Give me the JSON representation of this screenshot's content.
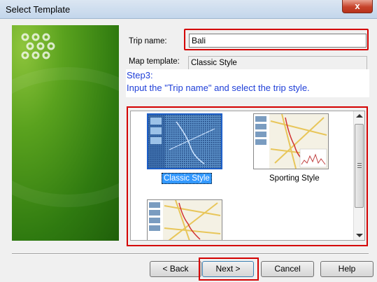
{
  "window": {
    "title": "Select Template",
    "close_label": "x"
  },
  "form": {
    "trip_name_label": "Trip name:",
    "trip_name_value": "Bali",
    "map_template_label": "Map template:",
    "map_template_value": "Classic Style"
  },
  "instructions": {
    "step": "Step3:",
    "text": "Input the \"Trip name\" and select the trip style."
  },
  "templates": [
    {
      "label": "Classic Style",
      "selected": true
    },
    {
      "label": "Sporting Style",
      "selected": false
    },
    {
      "label": "",
      "selected": false
    }
  ],
  "buttons": {
    "back": "< Back",
    "next": "Next >",
    "cancel": "Cancel",
    "help": "Help"
  },
  "colors": {
    "accent_red": "#d40000",
    "step_blue": "#1f3fd8",
    "selection_blue": "#3399ff",
    "panel_green": "#2f7a10"
  }
}
